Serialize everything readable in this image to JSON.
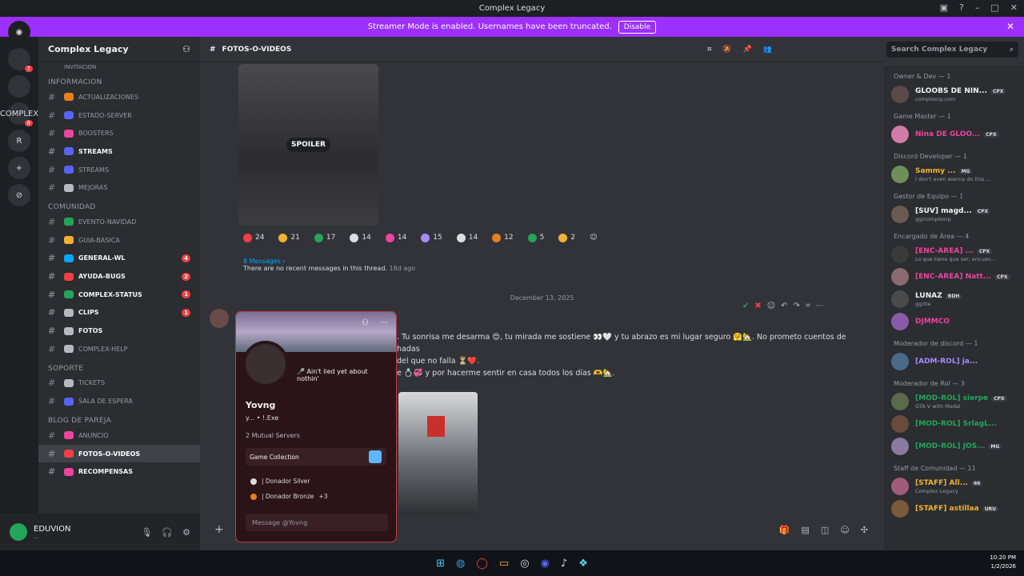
{
  "window": {
    "title": "Complex Legacy"
  },
  "banner": {
    "text": "Streamer Mode is enabled. Usernames have been truncated.",
    "button": "Disable"
  },
  "guilds": [
    {
      "label": "",
      "badge": "7"
    },
    {
      "label": "",
      "badge": ""
    },
    {
      "label": "COMPLEX",
      "badge": "8"
    },
    {
      "label": "R",
      "badge": ""
    },
    {
      "label": "+",
      "badge": ""
    },
    {
      "label": "⊘",
      "badge": ""
    }
  ],
  "server": {
    "name": "Complex Legacy"
  },
  "channel_header": {
    "name": "FOTOS-O-VIDEOS",
    "search_placeholder": "Search Complex Legacy"
  },
  "sidebar": {
    "truncated_top": "INVITACION",
    "categories": [
      {
        "name": "INFORMACION",
        "channels": [
          {
            "name": "ACTUALIZACIONES",
            "unread": false,
            "badge": "",
            "color": "#e67e22"
          },
          {
            "name": "ESTADO-SERVER",
            "unread": false,
            "badge": "",
            "color": "#5865f2"
          },
          {
            "name": "BOOSTERS",
            "unread": false,
            "badge": "",
            "color": "#eb459e"
          },
          {
            "name": "STREAMS",
            "unread": true,
            "badge": "",
            "color": "#5865f2"
          },
          {
            "name": "STREAMS",
            "unread": false,
            "badge": "",
            "color": "#5865f2"
          },
          {
            "name": "MEJORAS",
            "unread": false,
            "badge": "",
            "color": "#b5bac1"
          }
        ]
      },
      {
        "name": "COMUNIDAD",
        "channels": [
          {
            "name": "EVENTO-NAVIDAD",
            "unread": false,
            "badge": "",
            "color": "#23a55a"
          },
          {
            "name": "GUIA-BASICA",
            "unread": false,
            "badge": "",
            "color": "#f0b232"
          },
          {
            "name": "GENERAL-WL",
            "unread": true,
            "badge": "4",
            "color": "#00a8fc"
          },
          {
            "name": "AYUDA-BUGS",
            "unread": true,
            "badge": "2",
            "color": "#f23f43"
          },
          {
            "name": "COMPLEX-STATUS",
            "unread": true,
            "badge": "1",
            "color": "#23a55a"
          },
          {
            "name": "CLIPS",
            "unread": true,
            "badge": "1",
            "color": "#b5bac1"
          },
          {
            "name": "FOTOS",
            "unread": true,
            "badge": "",
            "color": "#b5bac1"
          },
          {
            "name": "COMPLEX-HELP",
            "unread": false,
            "badge": "",
            "color": "#b5bac1"
          }
        ]
      },
      {
        "name": "SOPORTE",
        "channels": [
          {
            "name": "TICKETS",
            "unread": false,
            "badge": "",
            "color": "#b5bac1"
          },
          {
            "name": "SALA DE ESPERA",
            "unread": false,
            "badge": "",
            "color": "#5865f2"
          }
        ]
      },
      {
        "name": "BLOG DE PAREJA",
        "channels": [
          {
            "name": "ANUNCIO",
            "unread": false,
            "badge": "",
            "color": "#eb459e"
          },
          {
            "name": "FOTOS-O-VIDEOS",
            "unread": true,
            "badge": "",
            "color": "#f23f43",
            "active": true
          },
          {
            "name": "RECOMPENSAS",
            "unread": true,
            "badge": "",
            "color": "#eb459e"
          }
        ]
      }
    ]
  },
  "user": {
    "name": "EDUVION",
    "status": "..."
  },
  "message": {
    "spoiler_label": "SPOILER",
    "reactions": [
      {
        "count": "24",
        "color": "#f23f43"
      },
      {
        "count": "21",
        "color": "#f0b232"
      },
      {
        "count": "17",
        "color": "#23a55a"
      },
      {
        "count": "14",
        "color": "#dbdee1"
      },
      {
        "count": "14",
        "color": "#eb459e"
      },
      {
        "count": "15",
        "color": "#a78bfa"
      },
      {
        "count": "14",
        "color": "#dbdee1"
      },
      {
        "count": "12",
        "color": "#e67e22"
      },
      {
        "count": "5",
        "color": "#23a55a"
      },
      {
        "count": "2",
        "color": "#f0b232"
      }
    ],
    "thread_link": "8 Messages ›",
    "thread_text": "There are no recent messages in this thread.",
    "thread_age": "18d ago",
    "date_divider": "December 13, 2025",
    "line1": ". Tu sonrisa me desarma 😍, tu mirada me sostiene 👀🤍 y tu abrazo es mi lugar seguro 🤗🏡. No prometo cuentos de hadas",
    "line2": "del que no falla ⏳❤️.",
    "line3": "e 💍💞 y por hacerme sentir en casa todos los días 🫶🏡."
  },
  "profile": {
    "status": "🎤 Ain't lied yet about nothin'",
    "name": "Yovng",
    "tag": "y... • !.Exe",
    "mutual": "2 Mutual Servers",
    "game_collection": "Game Collection",
    "roles": [
      "| Donador Silver",
      "| Donador Bronze"
    ],
    "more_roles": "+3",
    "message_placeholder": "Message @Yovng"
  },
  "members": [
    {
      "category": "Owner & Dev — 1",
      "items": [
        {
          "name": "GLOOBS DE NIN...",
          "sub": "complexrp.com",
          "color": "#f2f3f5",
          "tag": "CPX"
        }
      ]
    },
    {
      "category": "Game Master — 1",
      "items": [
        {
          "name": "Nina DE GLOO...",
          "sub": "",
          "color": "#eb459e",
          "tag": "CPX"
        }
      ]
    },
    {
      "category": "Discord Developer — 1",
      "items": [
        {
          "name": "Sammy ...",
          "sub": "I don't even wanna do this ...",
          "color": "#f0b232",
          "tag": "MG"
        }
      ]
    },
    {
      "category": "Gestor de Equipo — 1",
      "items": [
        {
          "name": "[SUV] magd...",
          "sub": "gg/complexrp",
          "color": "#f2f3f5",
          "tag": "CPX"
        }
      ]
    },
    {
      "category": "Encargado de Área — 4",
      "items": [
        {
          "name": "[ENC-AREA] ...",
          "sub": "Lo que tiene que ser, encuen...",
          "color": "#eb459e",
          "tag": "CPX"
        },
        {
          "name": "[ENC-AREA] Natt...",
          "sub": "",
          "color": "#eb459e",
          "tag": "CPX"
        },
        {
          "name": "LUNAZ",
          "sub": "gg/tte",
          "color": "#f2f3f5",
          "tag": "BDH"
        },
        {
          "name": "DJMMCO",
          "sub": "",
          "color": "#eb459e",
          "tag": ""
        }
      ]
    },
    {
      "category": "Moderador de discord — 1",
      "items": [
        {
          "name": "[ADM-ROL] ja...",
          "sub": "",
          "color": "#a78bfa",
          "tag": ""
        }
      ]
    },
    {
      "category": "Moderador de Rol — 3",
      "items": [
        {
          "name": "[MOD-ROL] sierpe",
          "sub": "GTA V with Medal",
          "color": "#23a55a",
          "tag": "CPX"
        },
        {
          "name": "[MOD-ROL] SrlagL...",
          "sub": "",
          "color": "#23a55a",
          "tag": ""
        },
        {
          "name": "[MOD-ROL] JOS...",
          "sub": "",
          "color": "#23a55a",
          "tag": "MG"
        }
      ]
    },
    {
      "category": "Staff de Comunidad — 11",
      "items": [
        {
          "name": "[STAFF] All...",
          "sub": "Complex Legacy",
          "color": "#f0b232",
          "tag": "66"
        },
        {
          "name": "[STAFF] astillaa",
          "sub": "",
          "color": "#f0b232",
          "tag": "URU"
        }
      ]
    }
  ],
  "taskbar": {
    "time": "10:20 PM",
    "date": "1/2/2026"
  }
}
